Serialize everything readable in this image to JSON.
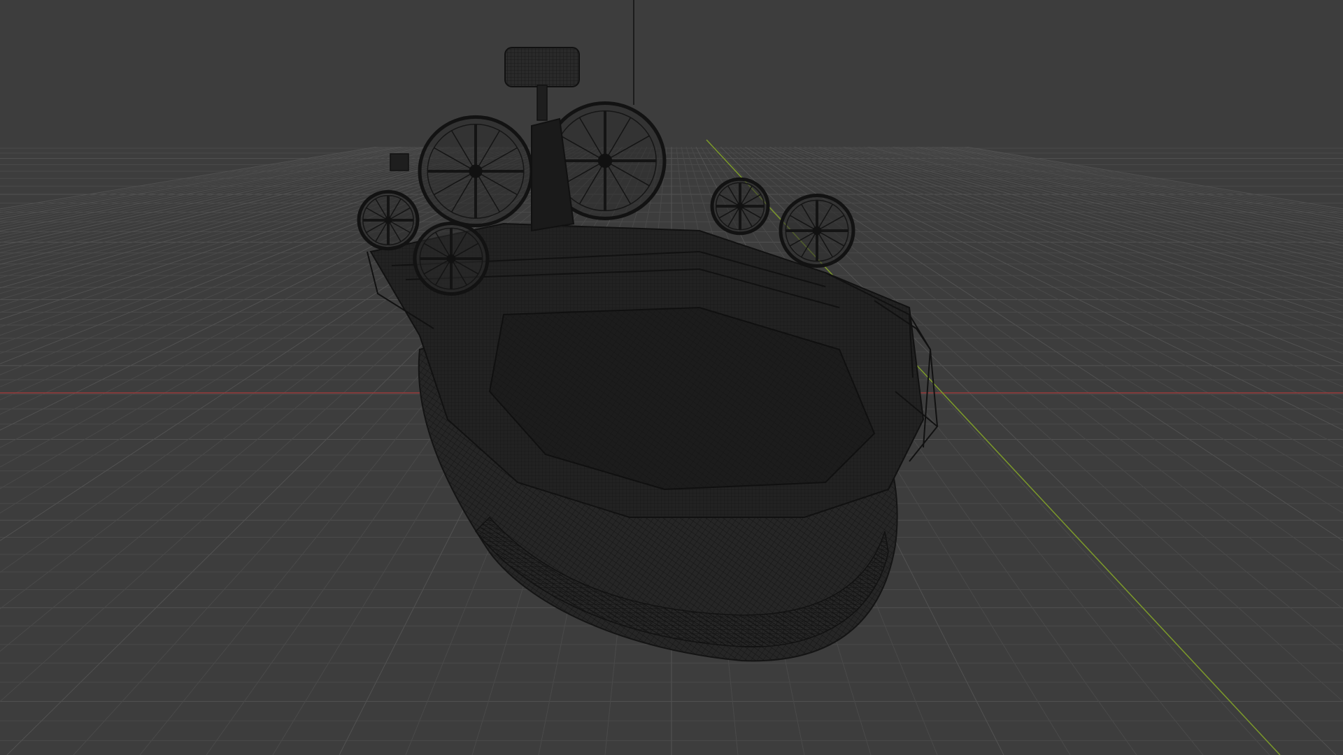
{
  "viewport": {
    "background_color": "#3d3d3d",
    "grid_color": "#4a4a4a",
    "grid_major_color": "#525252",
    "x_axis_color": "#9a3b3b",
    "y_axis_color": "#7c9a2a",
    "wire_color": "#141414",
    "wire_fill": "#262626",
    "model_icon": "hovercraft-wireframe"
  }
}
